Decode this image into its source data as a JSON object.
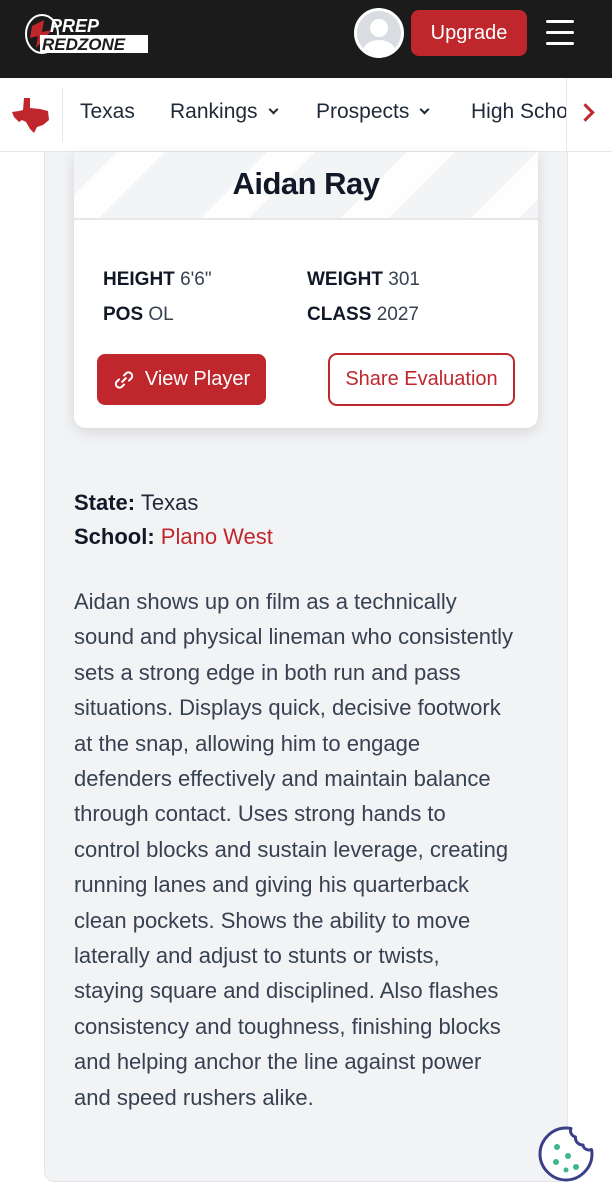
{
  "header": {
    "logo_line1": "PREP",
    "logo_line2": "REDZONE",
    "upgrade_label": "Upgrade",
    "accent_color": "#c0272d"
  },
  "subnav": {
    "items": [
      {
        "label": "Texas",
        "has_dropdown": false
      },
      {
        "label": "Rankings",
        "has_dropdown": true
      },
      {
        "label": "Prospects",
        "has_dropdown": true
      },
      {
        "label": "High Scho",
        "has_dropdown": false
      }
    ]
  },
  "player": {
    "name": "Aidan Ray",
    "height_label": "HEIGHT",
    "height_value": "6'6\"",
    "weight_label": "WEIGHT",
    "weight_value": "301",
    "pos_label": "POS",
    "pos_value": "OL",
    "class_label": "CLASS",
    "class_value": "2027",
    "view_label": "View Player",
    "share_label": "Share Evaluation"
  },
  "details": {
    "state_label": "State:",
    "state_value": "Texas",
    "school_label": "School:",
    "school_value": "Plano West"
  },
  "evaluation": {
    "lines": [
      "Aidan shows up on film as a technically",
      "sound and physical lineman who consistently",
      "sets a strong edge in both run and pass",
      "situations. Displays quick, decisive footwork",
      "at the snap, allowing him to engage",
      "defenders effectively and maintain balance",
      "through contact. Uses strong hands to",
      "control blocks and sustain leverage, creating",
      "running lanes and giving his quarterback",
      "clean pockets. Shows the ability to move",
      "laterally and adjust to stunts or twists,",
      "staying square and disciplined. Also flashes",
      "consistency and toughness, finishing blocks",
      "and helping anchor the line against power",
      "and speed rushers alike."
    ]
  },
  "icons": {
    "state": "texas-state-icon",
    "menu": "hamburger-icon",
    "link": "link-icon",
    "cookie": "cookie-icon"
  }
}
